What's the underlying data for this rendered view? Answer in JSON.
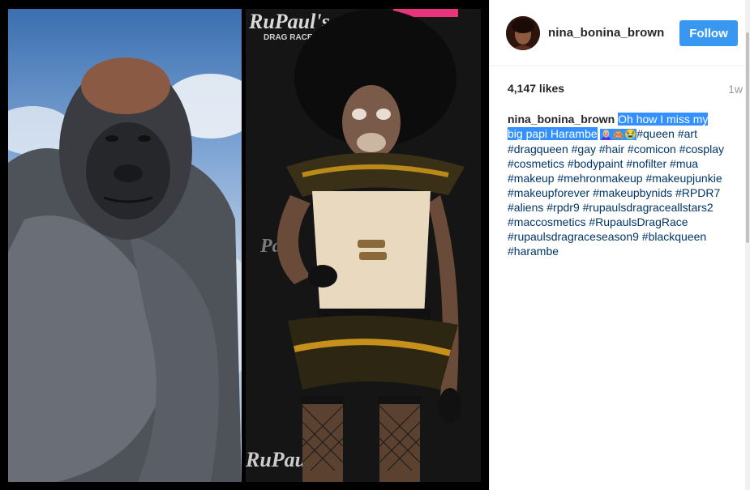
{
  "post": {
    "username": "nina_bonina_brown",
    "follow_label": "Follow",
    "likes": "4,147 likes",
    "time_ago": "1w",
    "caption": {
      "author": "nina_bonina_brown",
      "text_line1": "Oh how I miss my",
      "text_line2": "big papi Harambe",
      "emojis": "👩🏼‍🦲🙈😭",
      "hashtags": [
        "#queen",
        "#art",
        "#dragqueen",
        "#gay",
        "#hair",
        "#comicon",
        "#cosplay",
        "#cosmetics",
        "#bodypaint",
        "#nofilter",
        "#mua",
        "#makeup",
        "#mehronmakeup",
        "#makeupjunkie",
        "#makeupforever",
        "#makeupbynids",
        "#RPDR7",
        "#aliens",
        "#rpdr9",
        "#rupaulsdragraceallstars2",
        "#maccosmetics",
        "#RupaulsDragRace",
        "#rupaulsdragraceseason9",
        "#blackqueen",
        "#harambe"
      ]
    }
  },
  "media": {
    "backdrop_text_top": "RuPaul's",
    "backdrop_text_sub": "DRAG RACE"
  }
}
